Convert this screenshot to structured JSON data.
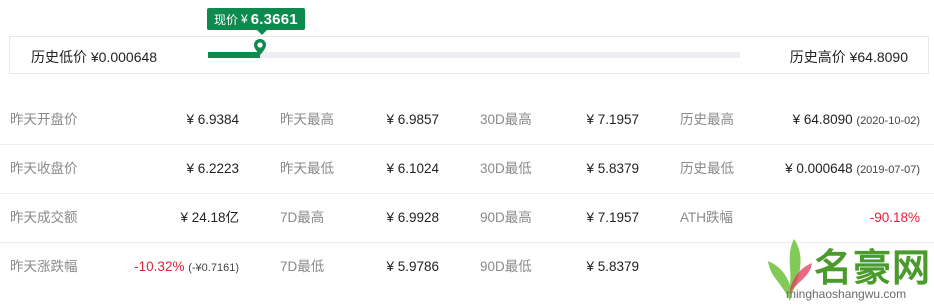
{
  "current": {
    "label": "现价",
    "symbol": "¥",
    "value": "6.3661",
    "position_fraction": 0.098
  },
  "range": {
    "low_label": "历史低价 ¥0.000648",
    "high_label": "历史高价 ¥64.8090"
  },
  "stats": [
    [
      {
        "key": "昨天开盘价",
        "value": "¥ 6.9384"
      },
      {
        "key": "昨天最高",
        "value": "¥ 6.9857"
      },
      {
        "key": "30D最高",
        "value": "¥ 7.1957"
      },
      {
        "key": "历史最高",
        "value": "¥ 64.8090",
        "sub": "(2020-10-02)"
      }
    ],
    [
      {
        "key": "昨天收盘价",
        "value": "¥ 6.2223"
      },
      {
        "key": "昨天最低",
        "value": "¥ 6.1024"
      },
      {
        "key": "30D最低",
        "value": "¥ 5.8379"
      },
      {
        "key": "历史最低",
        "value": "¥ 0.000648",
        "sub": "(2019-07-07)"
      }
    ],
    [
      {
        "key": "昨天成交额",
        "value": "¥ 24.18亿"
      },
      {
        "key": "7D最高",
        "value": "¥ 6.9928"
      },
      {
        "key": "90D最高",
        "value": "¥ 7.1957"
      },
      {
        "key": "ATH跌幅",
        "value": "-90.18%"
      }
    ],
    [
      {
        "key": "昨天涨跌幅",
        "value": "-10.32%",
        "sub": "(-¥0.7161)"
      },
      {
        "key": "7D最低",
        "value": "¥ 5.9786"
      },
      {
        "key": "90D最低",
        "value": "¥ 5.8379"
      },
      {
        "key": "",
        "value": ""
      }
    ]
  ],
  "watermark": {
    "name": "名豪网",
    "url": "minghaoshangwu.com"
  },
  "colors": {
    "accent_green": "#0f8a4f",
    "negative_red": "#e0223a"
  }
}
